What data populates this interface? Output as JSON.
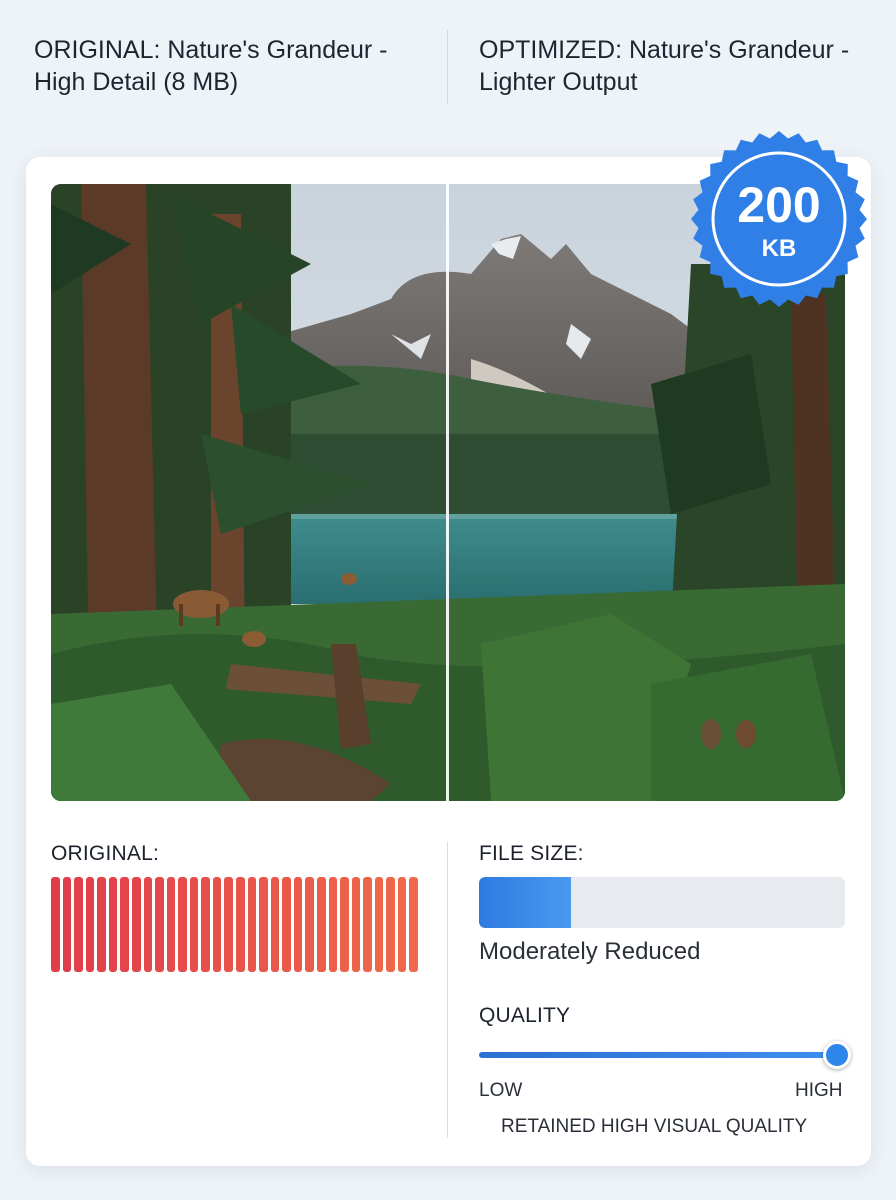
{
  "header": {
    "original_title": "ORIGINAL: Nature's Grandeur - High Detail (8 MB)",
    "optimized_title": "OPTIMIZED: Nature's Grandeur - Lighter Output"
  },
  "badge": {
    "value": "200",
    "unit": "KB",
    "color": "#2f7fe6"
  },
  "image": {
    "subject": "mountain lake forest with deer",
    "split": "left original / right optimized"
  },
  "original_panel": {
    "label": "ORIGINAL:",
    "bar_count": 32,
    "color_start": "#e03c4a",
    "color_end": "#ee6a4a"
  },
  "optimized_panel": {
    "file_size_label": "FILE SIZE:",
    "file_size_fraction": 0.25,
    "file_size_text": "Moderately Reduced",
    "quality_label": "QUALITY",
    "quality_fraction": 1.0,
    "low_label": "LOW",
    "high_label": "HIGH",
    "quality_note": "RETAINED HIGH VISUAL QUALITY"
  }
}
